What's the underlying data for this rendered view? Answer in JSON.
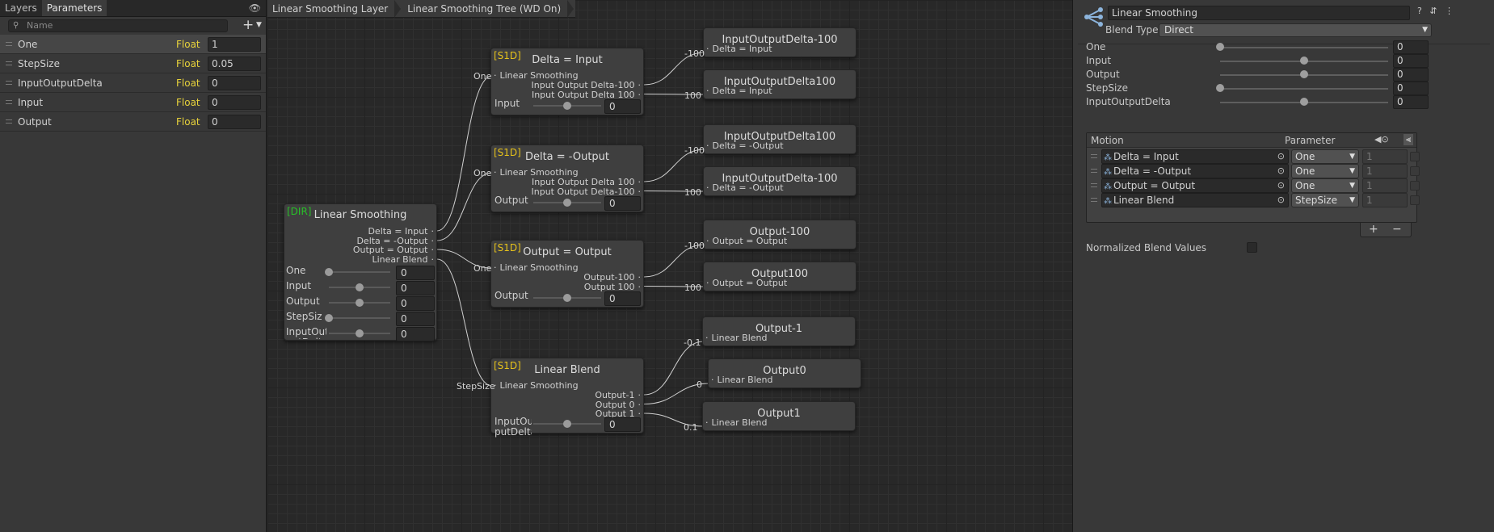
{
  "left": {
    "tabs": [
      "Layers",
      "Parameters"
    ],
    "search_placeholder": "Name",
    "eye_icon": "eye-icon",
    "parameters": [
      {
        "name": "One",
        "type": "Float",
        "value": "1"
      },
      {
        "name": "StepSize",
        "type": "Float",
        "value": "0.05"
      },
      {
        "name": "InputOutputDelta",
        "type": "Float",
        "value": "0"
      },
      {
        "name": "Input",
        "type": "Float",
        "value": "0"
      },
      {
        "name": "Output",
        "type": "Float",
        "value": "0"
      }
    ]
  },
  "breadcrumb": [
    "Linear Smoothing Layer",
    "Linear Smoothing Tree (WD On)"
  ],
  "graph": {
    "root": {
      "tag": "[DIR]",
      "title": "Linear Smoothing",
      "outputs": [
        "Delta = Input",
        "Delta = -Output",
        "Output = Output",
        "Linear Blend"
      ],
      "sliders": [
        {
          "label": "One",
          "value": "0",
          "level": 0.0
        },
        {
          "label": "Input",
          "value": "0",
          "level": 0.5
        },
        {
          "label": "Output",
          "value": "0",
          "level": 0.5
        },
        {
          "label": "StepSiz e",
          "value": "0",
          "level": 0.0
        },
        {
          "label": "InputOut putDelta",
          "value": "0",
          "level": 0.5
        }
      ]
    },
    "trees": [
      {
        "tag": "[S1D]",
        "title": "Delta = Input",
        "input": "Linear Smoothing",
        "input_weight": "One",
        "outputs": [
          "Input Output Delta-100",
          "Input Output Delta 100"
        ],
        "slider_label": "Input",
        "slider_value": "0",
        "level": 0.5
      },
      {
        "tag": "[S1D]",
        "title": "Delta = -Output",
        "input": "Linear Smoothing",
        "input_weight": "One",
        "outputs": [
          "Input Output Delta 100",
          "Input Output Delta-100"
        ],
        "slider_label": "Output",
        "slider_value": "0",
        "level": 0.5
      },
      {
        "tag": "[S1D]",
        "title": "Output = Output",
        "input": "Linear Smoothing",
        "input_weight": "One",
        "outputs": [
          "Output-100",
          "Output 100"
        ],
        "slider_label": "Output",
        "slider_value": "0",
        "level": 0.5
      },
      {
        "tag": "[S1D]",
        "title": "Linear Blend",
        "input": "Linear Smoothing",
        "input_weight": "StepSize",
        "outputs": [
          "Output-1",
          "Output 0",
          "Output 1"
        ],
        "slider_label": "InputOut putDelta",
        "slider_value": "0",
        "level": 0.5
      }
    ],
    "clips": [
      {
        "title": "InputOutputDelta-100",
        "input": "Delta = Input",
        "threshold": "-100"
      },
      {
        "title": "InputOutputDelta100",
        "input": "Delta = Input",
        "threshold": "100"
      },
      {
        "title": "InputOutputDelta100",
        "input": "Delta = -Output",
        "threshold": "-100"
      },
      {
        "title": "InputOutputDelta-100",
        "input": "Delta = -Output",
        "threshold": "100"
      },
      {
        "title": "Output-100",
        "input": "Output = Output",
        "threshold": "-100"
      },
      {
        "title": "Output100",
        "input": "Output = Output",
        "threshold": "100"
      },
      {
        "title": "Output-1",
        "input": "Linear Blend",
        "threshold": "-0.1"
      },
      {
        "title": "Output0",
        "input": "Linear Blend",
        "threshold": "0"
      },
      {
        "title": "Output1",
        "input": "Linear Blend",
        "threshold": "0.1"
      }
    ]
  },
  "inspector": {
    "name": "Linear Smoothing",
    "header_icons": "? ⇵ ⋮",
    "blend_type_label": "Blend Type",
    "blend_type": "Direct",
    "blend_params": [
      {
        "name": "One",
        "value": "0",
        "level": 0.0
      },
      {
        "name": "Input",
        "value": "0",
        "level": 0.5
      },
      {
        "name": "Output",
        "value": "0",
        "level": 0.5
      },
      {
        "name": "StepSize",
        "value": "0",
        "level": 0.0
      },
      {
        "name": "InputOutputDelta",
        "value": "0",
        "level": 0.5
      }
    ],
    "motion_header": "Motion",
    "parameter_header": "Parameter",
    "motions": [
      {
        "motion": "Delta = Input",
        "parameter": "One",
        "weight": "1"
      },
      {
        "motion": "Delta = -Output",
        "parameter": "One",
        "weight": "1"
      },
      {
        "motion": "Output = Output",
        "parameter": "One",
        "weight": "1"
      },
      {
        "motion": "Linear Blend",
        "parameter": "StepSize",
        "weight": "1"
      }
    ],
    "add_label": "+",
    "remove_label": "−",
    "normalized_label": "Normalized Blend Values",
    "colors": {
      "s1d_tag": "#e6c21b",
      "dir_tag": "#28c028",
      "float_type": "#e7d23b"
    }
  }
}
